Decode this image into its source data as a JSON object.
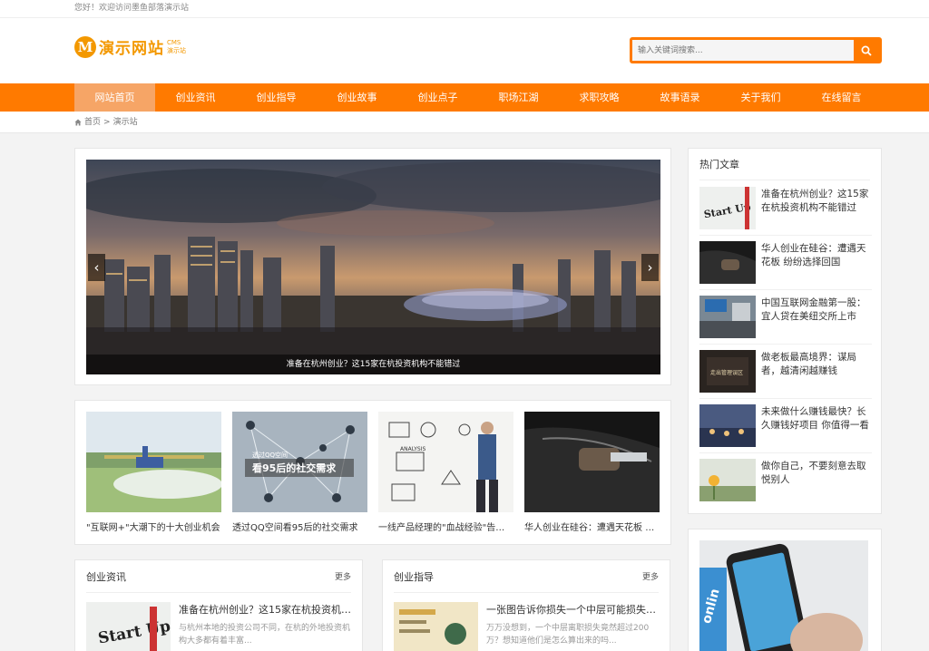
{
  "topbar": {
    "welcome": "您好！欢迎访问墨鱼部落演示站"
  },
  "logo": {
    "mark": "M",
    "name": "演示网站",
    "sub_line1": "CMS",
    "sub_line2": "演示站"
  },
  "search": {
    "placeholder": "输入关键词搜索..."
  },
  "nav": {
    "items": [
      "网站首页",
      "创业资讯",
      "创业指导",
      "创业故事",
      "创业点子",
      "职场江湖",
      "求职攻略",
      "故事语录",
      "关于我们",
      "在线留言"
    ]
  },
  "breadcrumb": {
    "home": "首页",
    "separator": ">",
    "current": "演示站"
  },
  "slider": {
    "caption": "准备在杭州创业？这15家在杭投资机构不能错过",
    "prev": "‹",
    "next": "›"
  },
  "thumbs": [
    {
      "title": "\"互联网+\"大潮下的十大创业机会"
    },
    {
      "title": "透过QQ空间看95后的社交需求"
    },
    {
      "title": "一线产品经理的\"血战经验\"告诉你..."
    },
    {
      "title": "华人创业在硅谷：遭遇天花板 纷纷选择回国"
    }
  ],
  "thumb_overlay": {
    "line1": "透过QQ空间",
    "line2": "看95后的社交需求"
  },
  "sections": [
    {
      "title": "创业资讯",
      "more": "更多",
      "article_title": "准备在杭州创业？这15家在杭投资机构不能错过",
      "article_desc": "与杭州本地的投资公司不同，在杭的外地投资机构大多都有着丰富..."
    },
    {
      "title": "创业指导",
      "more": "更多",
      "article_title": "一张图告诉你损失一个中层可能损失200万",
      "article_desc": "万万没想到，一个中层离职损失竟然超过200万？想知道他们是怎么算出来的吗..."
    }
  ],
  "hot": {
    "title": "热门文章",
    "items": [
      {
        "title": "准备在杭州创业？这15家在杭投资机构不能错过"
      },
      {
        "title": "华人创业在硅谷：遭遇天花板 纷纷选择回国"
      },
      {
        "title": "中国互联网金融第一股：宜人贷在美纽交所上市"
      },
      {
        "title": "做老板最高境界：谋局者，越清闲越赚钱"
      },
      {
        "title": "未来做什么赚钱最快？长久赚钱好项目 你值得一看"
      },
      {
        "title": "做你自己，不要刻意去取悦别人"
      }
    ]
  },
  "images": {
    "startup_text": "Start Up",
    "analysis_text": "ANALYSIS",
    "book_text": "走出管理误区",
    "ad_text": "onlin"
  },
  "colors": {
    "brand_orange": "#ff7a00",
    "nav_active": "#f6a566",
    "logo_orange": "#f39800"
  }
}
